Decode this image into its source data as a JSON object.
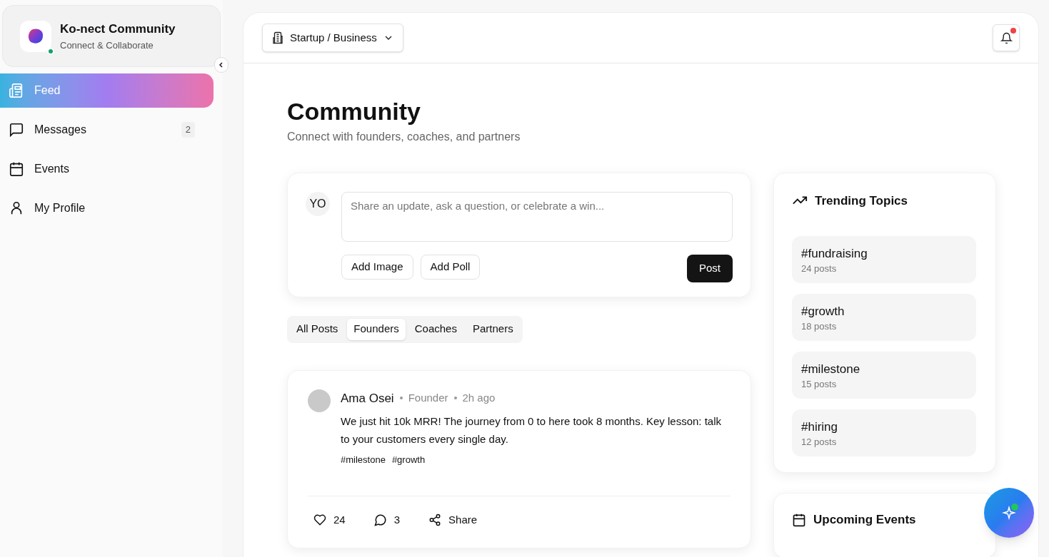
{
  "brand": {
    "name": "Ko-nect Community",
    "tagline": "Connect & Collaborate",
    "online": true
  },
  "sidebar": {
    "items": [
      {
        "kind": "feed",
        "label": "Feed",
        "selected": true
      },
      {
        "kind": "messages",
        "label": "Messages",
        "selected": false,
        "badge": "2"
      },
      {
        "kind": "events",
        "label": "Events",
        "selected": false
      },
      {
        "kind": "profile",
        "label": "My Profile",
        "selected": false
      }
    ]
  },
  "header": {
    "context_selector": "Startup / Business",
    "notifications_unread": true
  },
  "page": {
    "title": "Community",
    "subtitle": "Connect with founders, coaches, and partners"
  },
  "composer": {
    "avatar": "YO",
    "placeholder": "Share an update, ask a question, or celebrate a win...",
    "buttons": [
      "Add Image",
      "Add Poll"
    ],
    "submit": "Post"
  },
  "filter_tabs": [
    {
      "label": "All Posts",
      "selected": false
    },
    {
      "label": "Founders",
      "selected": true
    },
    {
      "label": "Coaches",
      "selected": false
    },
    {
      "label": "Partners",
      "selected": false
    }
  ],
  "posts": [
    {
      "author": "Ama Osei",
      "role": "Founder",
      "time": "2h ago",
      "text": "We just hit 10k MRR! The journey from 0 to here took 8 months. Key lesson: talk to your customers every single day.",
      "tags": [
        "#milestone",
        "#growth"
      ],
      "likes": "24",
      "comments": "3",
      "share": "Share"
    }
  ],
  "trending": {
    "title": "Trending Topics",
    "topics": [
      {
        "tag": "#fundraising",
        "count": "24 posts"
      },
      {
        "tag": "#growth",
        "count": "18 posts"
      },
      {
        "tag": "#milestone",
        "count": "15 posts"
      },
      {
        "tag": "#hiring",
        "count": "12 posts"
      }
    ]
  },
  "upcoming_events": {
    "title": "Upcoming Events"
  },
  "assistant_button": {
    "online": true
  }
}
